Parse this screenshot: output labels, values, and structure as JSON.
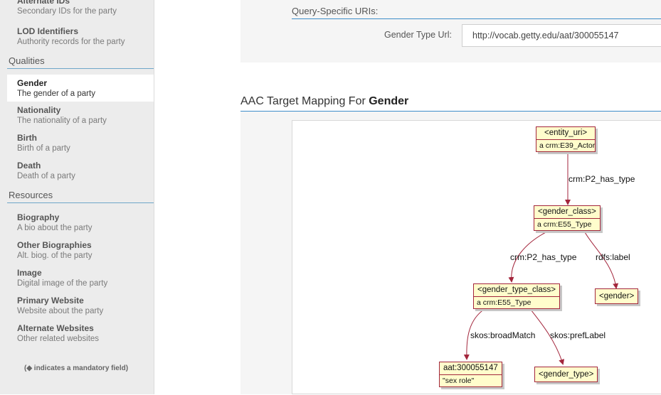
{
  "sidebar": {
    "top_partial": {
      "title": "Alternate IDs",
      "desc": "Secondary IDs for the party"
    },
    "lod": {
      "title": "LOD Identifiers",
      "desc": "Authority records for the party"
    },
    "qualities_heading": "Qualities",
    "gender": {
      "title": "Gender",
      "desc": "The gender of a party"
    },
    "nationality": {
      "title": "Nationality",
      "desc": "The nationality of a party"
    },
    "birth": {
      "title": "Birth",
      "desc": "Birth of a party"
    },
    "death": {
      "title": "Death",
      "desc": "Death of a party"
    },
    "resources_heading": "Resources",
    "biography": {
      "title": "Biography",
      "desc": "A bio about the party"
    },
    "other_bios": {
      "title": "Other Biographies",
      "desc": "Alt. biog. of the party"
    },
    "image": {
      "title": "Image",
      "desc": "Digital image of the party"
    },
    "primary_website": {
      "title": "Primary Website",
      "desc": "Website about the party"
    },
    "alt_websites": {
      "title": "Alternate Websites",
      "desc": "Other related websites"
    },
    "mandatory_note": "(◆ indicates a mandatory field)"
  },
  "query": {
    "title": "Query-Specific URIs:",
    "gender_type_url_label": "Gender Type Url:",
    "gender_type_url_value": "http://vocab.getty.edu/aat/300055147"
  },
  "mapping": {
    "heading_prefix": "AAC Target Mapping For ",
    "heading_bold": "Gender"
  },
  "diagram": {
    "nodes": {
      "entity_uri": {
        "name": "<entity_uri>",
        "class": "a crm:E39_Actor"
      },
      "gender_class": {
        "name": "<gender_class>",
        "class": "a crm:E55_Type"
      },
      "gender_type_class": {
        "name": "<gender_type_class>",
        "class": "a crm:E55_Type"
      },
      "gender": {
        "name": "<gender>"
      },
      "aat": {
        "name": "aat:300055147",
        "class": "\"sex role\""
      },
      "gender_type": {
        "name": "<gender_type>"
      }
    },
    "edges": {
      "e1": "crm:P2_has_type",
      "e2": "crm:P2_has_type",
      "e3": "rdfs:label",
      "e4": "skos:broadMatch",
      "e5": "skos:prefLabel"
    },
    "edge_color": "#a3263c",
    "node_fill": "#fffdcc"
  }
}
